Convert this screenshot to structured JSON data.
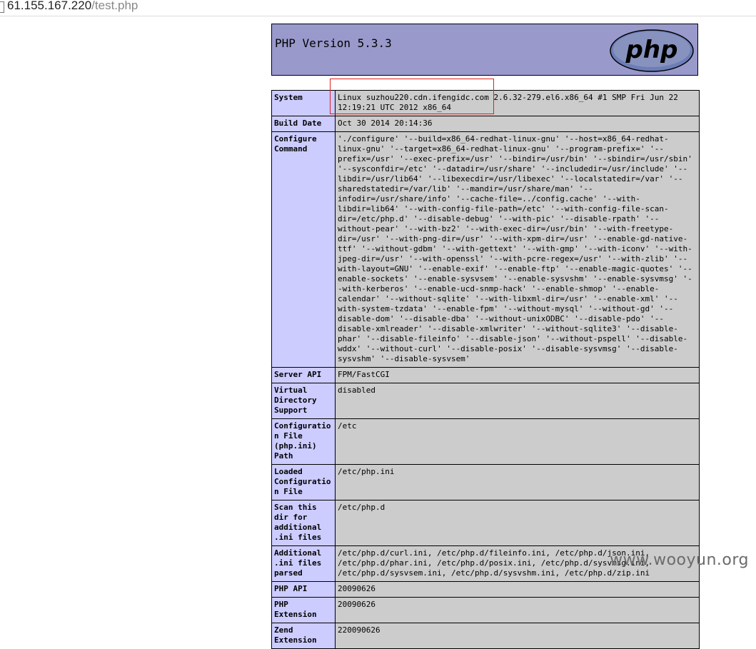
{
  "address_bar": {
    "host": "61.155.167.220",
    "path": "/test.php"
  },
  "header": {
    "title": "PHP Version 5.3.3",
    "logo_text": "php"
  },
  "rows": [
    {
      "label": "System",
      "value": "Linux suzhou220.cdn.ifengidc.com 2.6.32-279.el6.x86_64 #1 SMP Fri Jun 22 12:19:21 UTC 2012 x86_64"
    },
    {
      "label": "Build Date",
      "value": "Oct 30 2014 20:14:36"
    },
    {
      "label": "Configure Command",
      "value": "'./configure' '--build=x86_64-redhat-linux-gnu' '--host=x86_64-redhat-linux-gnu' '--target=x86_64-redhat-linux-gnu' '--program-prefix=' '--prefix=/usr' '--exec-prefix=/usr' '--bindir=/usr/bin' '--sbindir=/usr/sbin' '--sysconfdir=/etc' '--datadir=/usr/share' '--includedir=/usr/include' '--libdir=/usr/lib64' '--libexecdir=/usr/libexec' '--localstatedir=/var' '--sharedstatedir=/var/lib' '--mandir=/usr/share/man' '--infodir=/usr/share/info' '--cache-file=../config.cache' '--with-libdir=lib64' '--with-config-file-path=/etc' '--with-config-file-scan-dir=/etc/php.d' '--disable-debug' '--with-pic' '--disable-rpath' '--without-pear' '--with-bz2' '--with-exec-dir=/usr/bin' '--with-freetype-dir=/usr' '--with-png-dir=/usr' '--with-xpm-dir=/usr' '--enable-gd-native-ttf' '--without-gdbm' '--with-gettext' '--with-gmp' '--with-iconv' '--with-jpeg-dir=/usr' '--with-openssl' '--with-pcre-regex=/usr' '--with-zlib' '--with-layout=GNU' '--enable-exif' '--enable-ftp' '--enable-magic-quotes' '--enable-sockets' '--enable-sysvsem' '--enable-sysvshm' '--enable-sysvmsg' '--with-kerberos' '--enable-ucd-snmp-hack' '--enable-shmop' '--enable-calendar' '--without-sqlite' '--with-libxml-dir=/usr' '--enable-xml' '--with-system-tzdata' '--enable-fpm' '--without-mysql' '--without-gd' '--disable-dom' '--disable-dba' '--without-unixODBC' '--disable-pdo' '--disable-xmlreader' '--disable-xmlwriter' '--without-sqlite3' '--disable-phar' '--disable-fileinfo' '--disable-json' '--without-pspell' '--disable-wddx' '--without-curl' '--disable-posix' '--disable-sysvmsg' '--disable-sysvshm' '--disable-sysvsem'"
    },
    {
      "label": "Server API",
      "value": "FPM/FastCGI"
    },
    {
      "label": "Virtual Directory Support",
      "value": "disabled"
    },
    {
      "label": "Configuration File (php.ini) Path",
      "value": "/etc"
    },
    {
      "label": "Loaded Configuration File",
      "value": "/etc/php.ini"
    },
    {
      "label": "Scan this dir for additional .ini files",
      "value": "/etc/php.d"
    },
    {
      "label": "Additional .ini files parsed",
      "value": "/etc/php.d/curl.ini, /etc/php.d/fileinfo.ini, /etc/php.d/json.ini, /etc/php.d/phar.ini, /etc/php.d/posix.ini, /etc/php.d/sysvmsg.ini, /etc/php.d/sysvsem.ini, /etc/php.d/sysvshm.ini, /etc/php.d/zip.ini"
    },
    {
      "label": "PHP API",
      "value": "20090626"
    },
    {
      "label": "PHP Extension",
      "value": "20090626"
    },
    {
      "label": "Zend Extension",
      "value": "220090626"
    }
  ],
  "watermark": "www.wooyun.org",
  "colors": {
    "header_bg": "#9999cc",
    "label_bg": "#ccccff",
    "value_bg": "#cccccc",
    "highlight_box": "#e02020"
  }
}
